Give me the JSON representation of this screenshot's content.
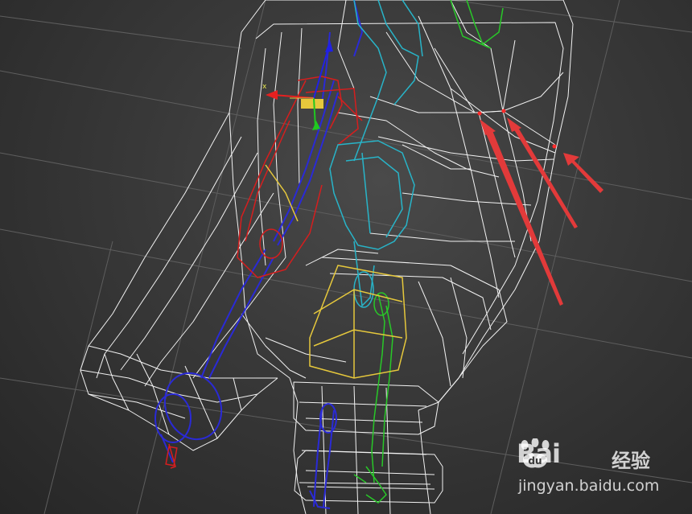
{
  "viewport": {
    "name": "3d-viewport-wireframe",
    "colors": {
      "background": "#3a3a3a",
      "grid": "#5a5a5a",
      "mesh": "#f2f2f2",
      "bone_red": "#d61e1e",
      "bone_blue": "#2a2ad6",
      "bone_cyan": "#28b4c8",
      "bone_green": "#28c828",
      "bone_yellow": "#e6c83c",
      "gizmo_x": "#e62020",
      "gizmo_y": "#20c820",
      "gizmo_z": "#2020e6",
      "annotation_arrow": "#e23a3a"
    },
    "gizmo": {
      "x_label": "x"
    },
    "selected_vertices": 3
  },
  "watermark": {
    "brand": "Bai",
    "name": "经验",
    "url": "jingyan.baidu.com",
    "paw_icon": "baidu-paw-icon"
  }
}
